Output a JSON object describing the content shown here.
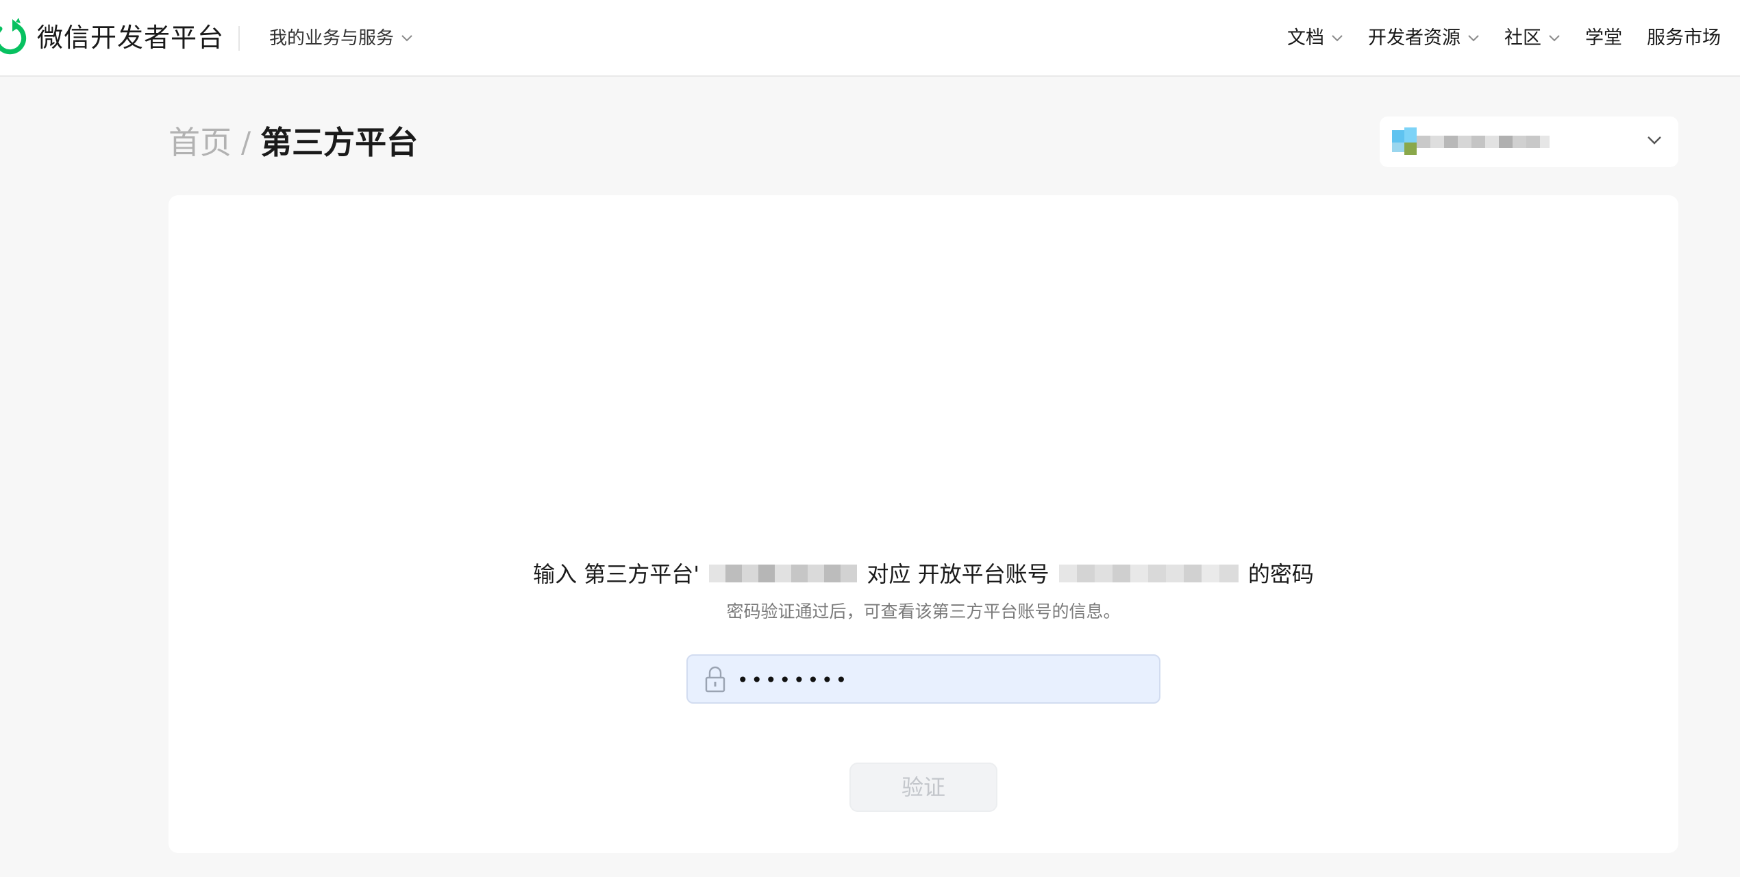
{
  "header": {
    "brand": "微信开发者平台",
    "biz_menu": "我的业务与服务",
    "nav": [
      {
        "label": "文档",
        "has_dropdown": true
      },
      {
        "label": "开发者资源",
        "has_dropdown": true
      },
      {
        "label": "社区",
        "has_dropdown": true
      },
      {
        "label": "学堂",
        "has_dropdown": false
      },
      {
        "label": "服务市场",
        "has_dropdown": false
      }
    ]
  },
  "breadcrumb": {
    "home": "首页",
    "separator": "/",
    "current": "第三方平台"
  },
  "account_selector": {
    "icon": "chevron-down-icon"
  },
  "verify": {
    "prompt_prefix": "输入 第三方平台'",
    "prompt_middle": "对应  开放平台账号",
    "prompt_suffix": "的密码",
    "subtitle": "密码验证通过后，可查看该第三方平台账号的信息。",
    "password_value": "••••••••",
    "button_label": "验证"
  },
  "colors": {
    "brand_green": "#07c160",
    "input_bg": "#e8f0fe",
    "button_disabled_bg": "#f2f3f5",
    "page_bg": "#f7f7f7"
  }
}
